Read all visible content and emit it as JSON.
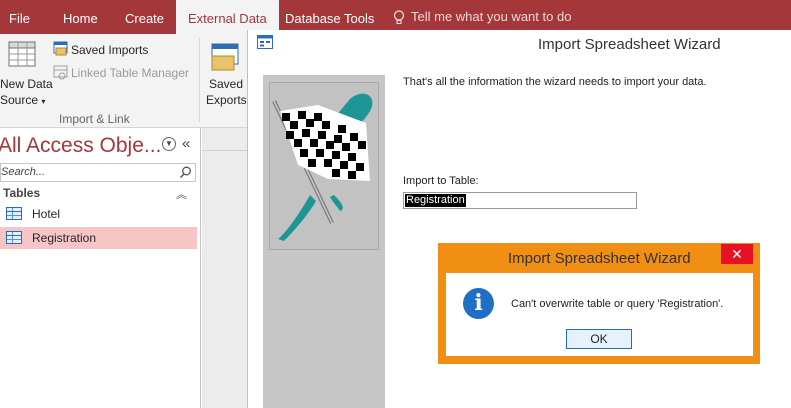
{
  "ribbon": {
    "tabs": [
      {
        "label": "File"
      },
      {
        "label": "Home"
      },
      {
        "label": "Create"
      },
      {
        "label": "External Data"
      },
      {
        "label": "Database Tools"
      }
    ],
    "tell_me": "Tell me what you want to do",
    "new_data_source_line1": "New Data",
    "new_data_source_line2": "Source",
    "saved_imports": "Saved Imports",
    "linked_table_manager": "Linked Table Manager",
    "import_link_group": "Import & Link",
    "saved_exports_line1": "Saved",
    "saved_exports_line2": "Exports"
  },
  "nav": {
    "title": "All Access Obje...",
    "search_placeholder": "Search...",
    "section": "Tables",
    "items": [
      {
        "label": "Hotel"
      },
      {
        "label": "Registration"
      }
    ]
  },
  "wizard": {
    "title": "Import Spreadsheet Wizard",
    "message": "That's all the information the wizard needs to import your data.",
    "import_to_label": "Import to Table:",
    "import_to_value": "Registration"
  },
  "dialog": {
    "title": "Import Spreadsheet Wizard",
    "message": "Can't overwrite table or query 'Registration'.",
    "ok_label": "OK",
    "close_glyph": "✕"
  },
  "colors": {
    "access_accent": "#a4373a",
    "dialog_frame": "#f18e14",
    "selected_row": "#f7c5c6",
    "flag_teal": "#1f9696"
  }
}
